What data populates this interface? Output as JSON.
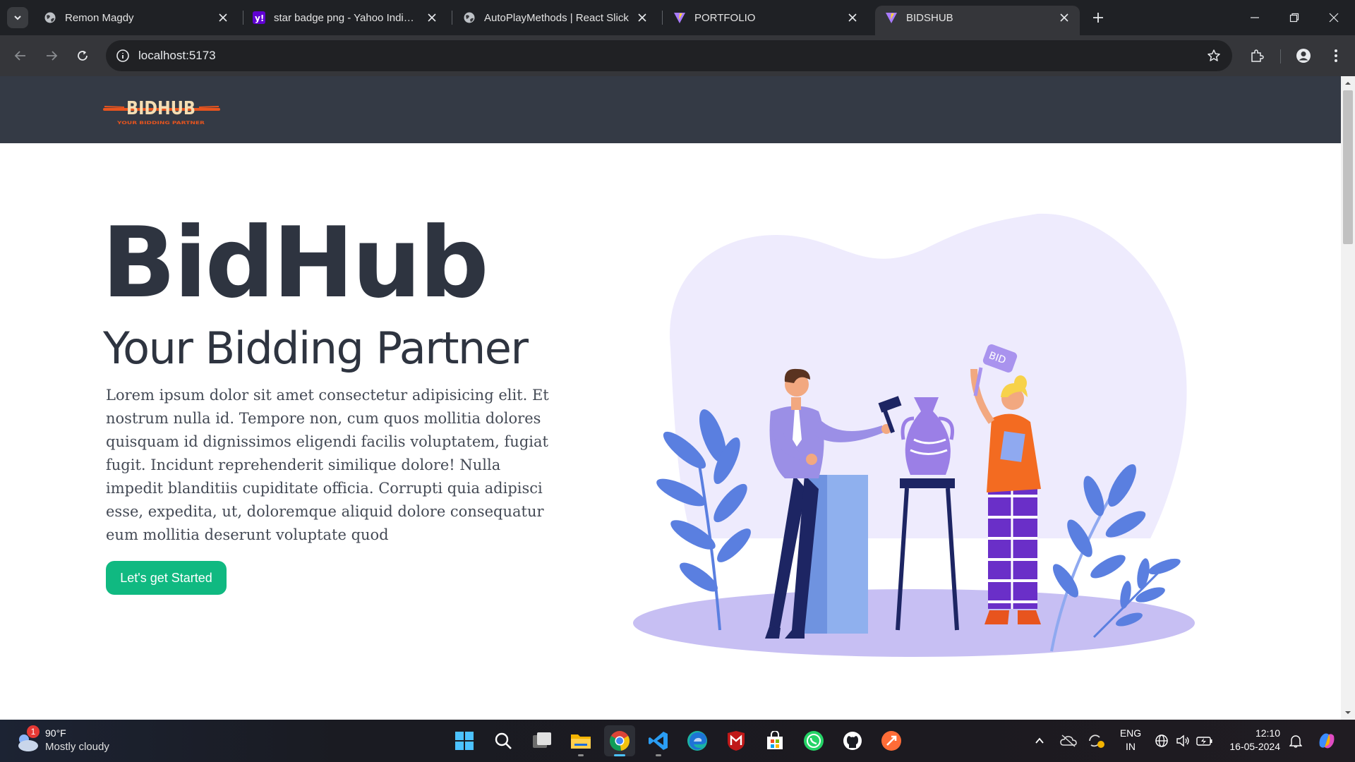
{
  "browser": {
    "tabs": [
      {
        "title": "Remon Magdy",
        "icon": "globe-icon",
        "active": false
      },
      {
        "title": "star badge png - Yahoo India Im",
        "icon": "yahoo-icon",
        "active": false
      },
      {
        "title": "AutoPlayMethods | React Slick",
        "icon": "globe-icon",
        "active": false
      },
      {
        "title": "PORTFOLIO",
        "icon": "vite-icon",
        "active": false
      },
      {
        "title": "BIDSHUB",
        "icon": "vite-icon",
        "active": true
      }
    ],
    "url": "localhost:5173"
  },
  "page": {
    "logo_text": "BIDHUB",
    "logo_tagline": "YOUR BIDDING PARTNER",
    "title": "BidHub",
    "subtitle": "Your Bidding Partner",
    "description": "Lorem ipsum dolor sit amet consectetur adipisicing elit. Et nostrum nulla id. Tempore non, cum quos mollitia dolores quisquam id dignissimos eligendi facilis voluptatem, fugiat fugit. Incidunt reprehenderit similique dolore! Nulla impedit blanditiis cupiditate officia. Corrupti quia adipisci esse, expedita, ut, doloremque aliquid dolore consequatur eum mollitia deserunt voluptate quod",
    "cta_label": "Let's get Started",
    "illustration_sign": "BID",
    "colors": {
      "navbar": "#343a45",
      "cta": "#10b981",
      "heading": "#2e3440",
      "logo_accent": "#e8541e",
      "logo_text": "#f5deb3"
    }
  },
  "taskbar": {
    "weather": {
      "temp": "90°F",
      "desc": "Mostly cloudy",
      "badge": "1"
    },
    "apps": [
      "start-icon",
      "search-icon",
      "task-view-icon",
      "file-explorer-icon",
      "chrome-icon",
      "vscode-icon",
      "edge-icon",
      "mcafee-icon",
      "microsoft-store-icon",
      "whatsapp-icon",
      "github-icon",
      "postman-icon"
    ],
    "lang": {
      "line1": "ENG",
      "line2": "IN"
    },
    "time": "12:10",
    "date": "16-05-2024"
  }
}
